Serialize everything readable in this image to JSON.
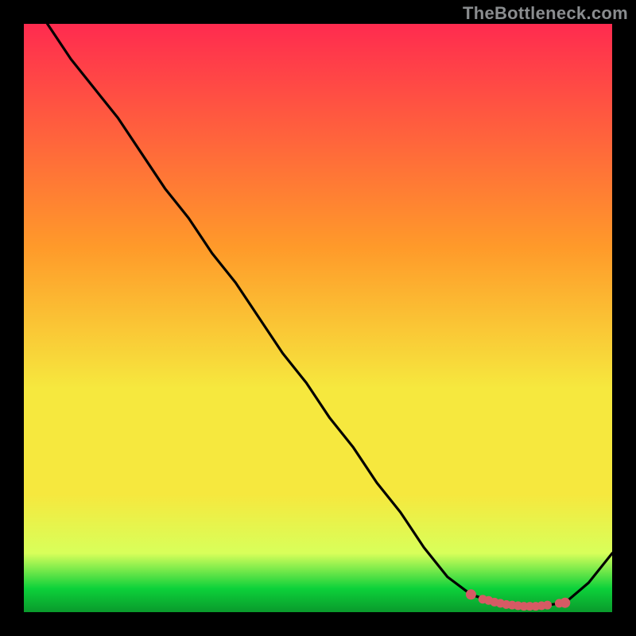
{
  "watermark": "TheBottleneck.com",
  "colors": {
    "background": "#000000",
    "gradient_top": "#ff2b4f",
    "gradient_mid1": "#ff9a2a",
    "gradient_mid2": "#f6e83e",
    "gradient_low": "#d8ff5a",
    "gradient_green": "#0cd13a",
    "gradient_dark_green": "#0a9a2c",
    "curve": "#000000",
    "marker": "#d65a64"
  },
  "chart_data": {
    "type": "line",
    "title": "",
    "subtitle": "",
    "xlabel": "",
    "ylabel": "",
    "xlim": [
      0,
      100
    ],
    "ylim": [
      0,
      100
    ],
    "grid": false,
    "legend": false,
    "annotations": [],
    "series": [
      {
        "name": "curve",
        "x": [
          4,
          8,
          12,
          16,
          20,
          24,
          28,
          32,
          36,
          40,
          44,
          48,
          52,
          56,
          60,
          64,
          68,
          72,
          76,
          79,
          81,
          83,
          85,
          87,
          89,
          92,
          96,
          100
        ],
        "y": [
          100,
          94,
          89,
          84,
          78,
          72,
          67,
          61,
          56,
          50,
          44,
          39,
          33,
          28,
          22,
          17,
          11,
          6,
          3,
          2,
          1.5,
          1.2,
          1,
          1,
          1.2,
          1.6,
          5,
          10
        ]
      }
    ],
    "markers": {
      "name": "highlight-dots",
      "x": [
        76,
        78,
        79,
        80,
        81,
        82,
        83,
        84,
        85,
        86,
        87,
        88,
        89,
        91,
        92
      ],
      "y": [
        3.0,
        2.2,
        2.0,
        1.7,
        1.5,
        1.3,
        1.2,
        1.1,
        1.0,
        1.0,
        1.0,
        1.1,
        1.2,
        1.5,
        1.6
      ]
    }
  }
}
